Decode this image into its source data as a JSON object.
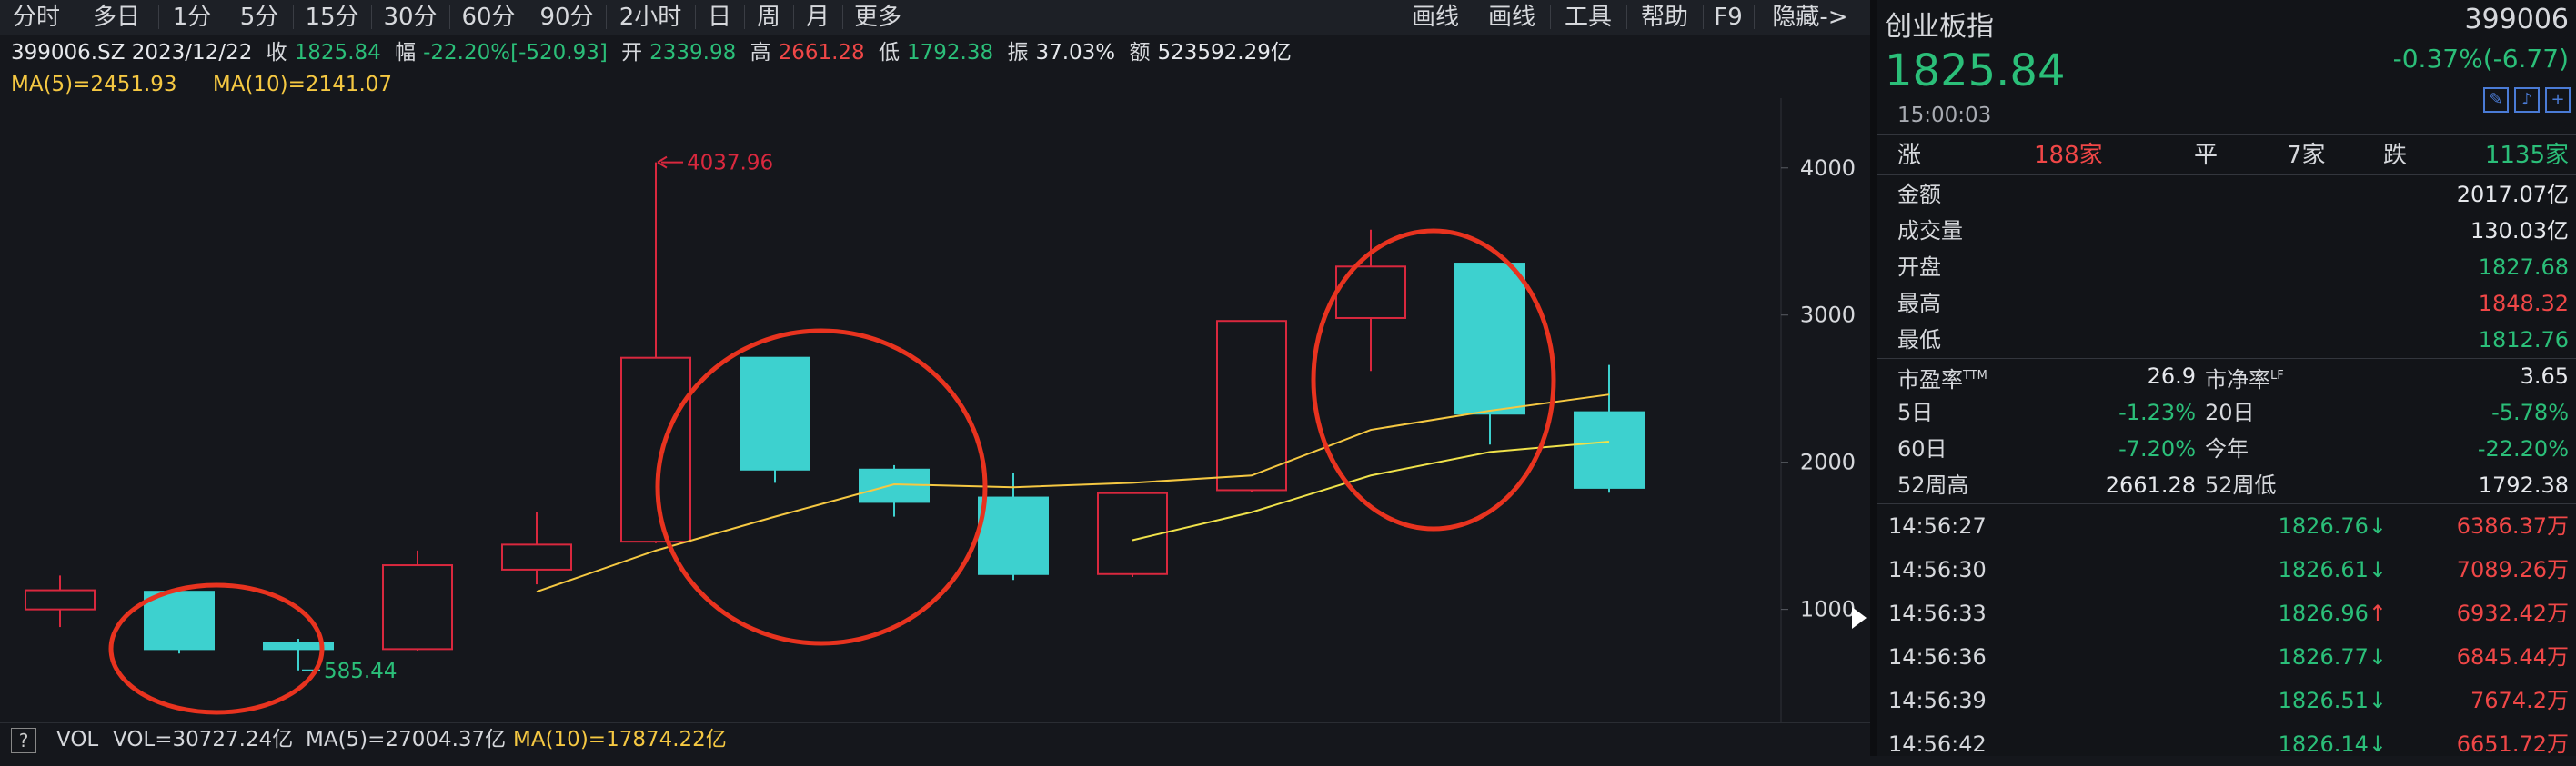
{
  "toolbar": {
    "left": [
      "分时",
      "多日",
      "1分",
      "5分",
      "15分",
      "30分",
      "60分",
      "90分",
      "2小时",
      "日",
      "周",
      "月",
      "更多"
    ],
    "right": [
      "画线",
      "画线",
      "工具",
      "帮助",
      "F9",
      "隐藏->"
    ]
  },
  "info": {
    "code_date": "399006.SZ 2023/12/22",
    "close_label": "收",
    "close": "1825.84",
    "change_label": "幅",
    "change": "-22.20%[-520.93]",
    "open_label": "开",
    "open": "2339.98",
    "high_label": "高",
    "high": "2661.28",
    "low_label": "低",
    "low": "1792.38",
    "amplitude_label": "振",
    "amplitude": "37.03%",
    "amount_label": "额",
    "amount": "523592.29亿"
  },
  "ma": {
    "ma5": "MA(5)=2451.93",
    "ma10": "MA(10)=2141.07"
  },
  "chart_data": {
    "type": "candlestick",
    "ylim": [
      300,
      4400
    ],
    "y_ticks": [
      "4000",
      "3000",
      "2000",
      "1000"
    ],
    "y_tick_values": [
      4000,
      3000,
      2000,
      1000
    ],
    "annotations": {
      "max_label": "4037.96",
      "min_label": "585.44"
    },
    "candles": [
      {
        "open": 1000,
        "close": 1130,
        "high": 1230,
        "low": 880,
        "dir": "up"
      },
      {
        "open": 1120,
        "close": 730,
        "high": 1140,
        "low": 700,
        "dir": "down"
      },
      {
        "open": 770,
        "close": 730,
        "high": 800,
        "low": 585.44,
        "dir": "down"
      },
      {
        "open": 730,
        "close": 1300,
        "high": 1400,
        "low": 720,
        "dir": "up"
      },
      {
        "open": 1270,
        "close": 1440,
        "high": 1660,
        "low": 1170,
        "dir": "up"
      },
      {
        "open": 1460,
        "close": 2710,
        "high": 4037.96,
        "low": 1450,
        "dir": "up"
      },
      {
        "open": 2710,
        "close": 1950,
        "high": 2710,
        "low": 1860,
        "dir": "down"
      },
      {
        "open": 1950,
        "close": 1730,
        "high": 1980,
        "low": 1630,
        "dir": "down"
      },
      {
        "open": 1760,
        "close": 1240,
        "high": 1930,
        "low": 1200,
        "dir": "down"
      },
      {
        "open": 1240,
        "close": 1790,
        "high": 1790,
        "low": 1220,
        "dir": "up"
      },
      {
        "open": 1810,
        "close": 2960,
        "high": 2960,
        "low": 1800,
        "dir": "up"
      },
      {
        "open": 2980,
        "close": 3330,
        "high": 3580,
        "low": 2620,
        "dir": "up"
      },
      {
        "open": 3350,
        "close": 2330,
        "high": 3350,
        "low": 2120,
        "dir": "down"
      },
      {
        "open": 2339.98,
        "close": 1825.84,
        "high": 2661.28,
        "low": 1792.38,
        "dir": "down"
      }
    ],
    "ma5": [
      null,
      null,
      null,
      null,
      1120,
      1400,
      1630,
      1850,
      1830,
      1860,
      1910,
      2220,
      2350,
      2460
    ],
    "ma10": [
      null,
      null,
      null,
      null,
      null,
      null,
      null,
      null,
      null,
      1470,
      1660,
      1910,
      2070,
      2140
    ]
  },
  "vol": {
    "q": "?",
    "label": "VOL",
    "vol": "VOL=30727.24亿",
    "ma5": "MA(5)=27004.37亿",
    "ma10": "MA(10)=17874.22亿"
  },
  "quote": {
    "name": "创业板指",
    "code": "399006",
    "price": "1825.84",
    "change": "-0.37%(-6.77)",
    "time": "15:00:03",
    "breadth": {
      "up_label": "涨",
      "up": "188家",
      "flat_label": "平",
      "flat": "7家",
      "down_label": "跌",
      "down": "1135家"
    },
    "rows": [
      {
        "label": "金额",
        "value": "2017.07亿",
        "color": "#e6e8ec"
      },
      {
        "label": "成交量",
        "value": "130.03亿",
        "color": "#e6e8ec"
      },
      {
        "label": "开盘",
        "value": "1827.68",
        "color": "#2bbf79"
      },
      {
        "label": "最高",
        "value": "1848.32",
        "color": "#f04747"
      },
      {
        "label": "最低",
        "value": "1812.76",
        "color": "#2bbf79"
      }
    ],
    "pe_label": "市盈率",
    "pe_sup": "TTM",
    "pe": "26.9",
    "pb_label": "市净率",
    "pb_sup": "LF",
    "pb": "3.65",
    "d5_label": "5日",
    "d5": "-1.23%",
    "d20_label": "20日",
    "d20": "-5.78%",
    "d60_label": "60日",
    "d60": "-7.20%",
    "ytd_label": "今年",
    "ytd": "-22.20%",
    "h52_label": "52周高",
    "h52": "2661.28",
    "l52_label": "52周低",
    "l52": "1792.38"
  },
  "ticks": [
    {
      "time": "14:56:27",
      "price": "1826.76",
      "dir": "down",
      "amount": "6386.37万"
    },
    {
      "time": "14:56:30",
      "price": "1826.61",
      "dir": "down",
      "amount": "7089.26万"
    },
    {
      "time": "14:56:33",
      "price": "1826.96",
      "dir": "up",
      "amount": "6932.42万"
    },
    {
      "time": "14:56:36",
      "price": "1826.77",
      "dir": "down",
      "amount": "6845.44万"
    },
    {
      "time": "14:56:39",
      "price": "1826.51",
      "dir": "down",
      "amount": "7674.2万"
    },
    {
      "time": "14:56:42",
      "price": "1826.14",
      "dir": "down",
      "amount": "6651.72万"
    }
  ],
  "colors": {
    "up": "#d9283e",
    "down": "#3dd1cf",
    "ma5": "#f5c842",
    "ma10": "#f0e24a",
    "circle": "#e8331f"
  }
}
